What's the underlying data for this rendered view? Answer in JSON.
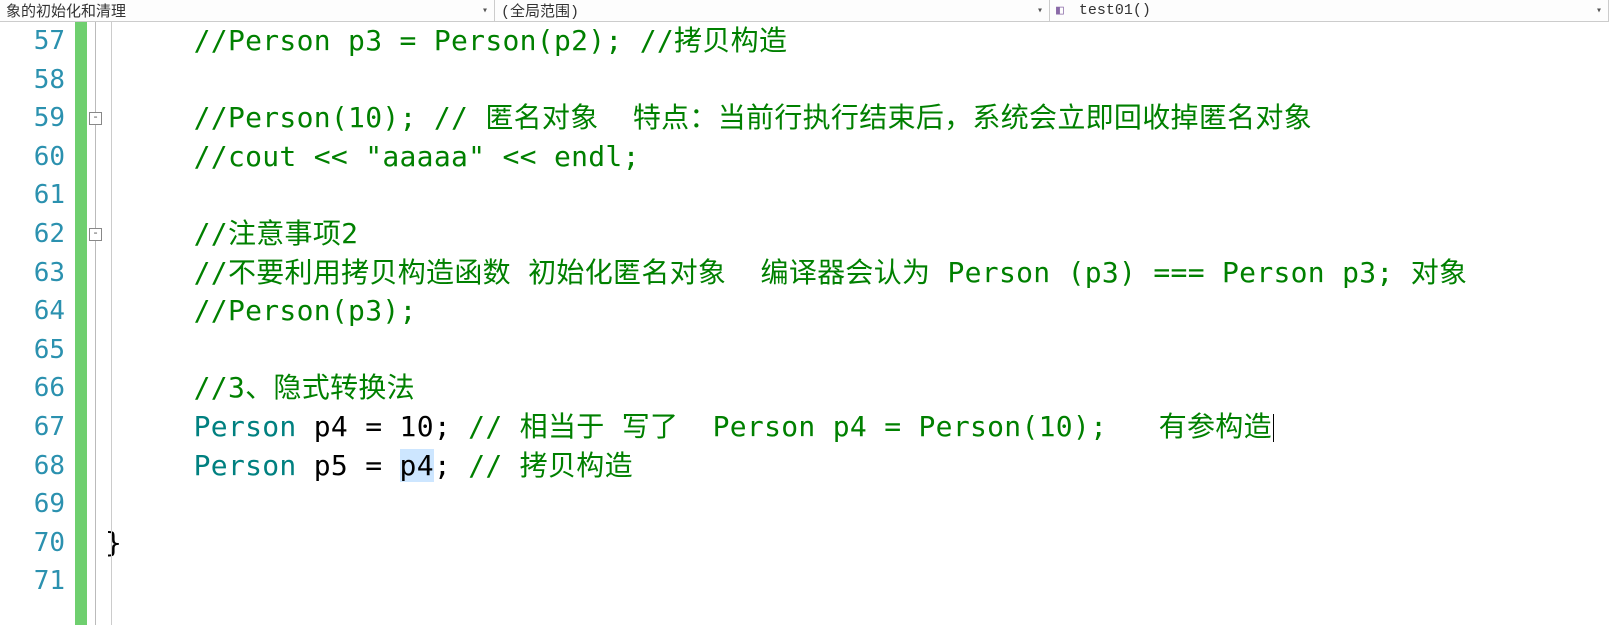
{
  "dropdowns": {
    "left": "象的初始化和清理",
    "middle": "(全局范围)",
    "right": "test01()"
  },
  "lines": {
    "start": 57,
    "end": 71
  },
  "fold": {
    "row59": "-",
    "row62": "-"
  },
  "code": {
    "l57": "//Person p3 = Person(p2); //拷贝构造",
    "l58": "",
    "l59": "//Person(10); // 匿名对象  特点：当前行执行结束后，系统会立即回收掉匿名对象",
    "l60": "//cout << \"aaaaa\" << endl;",
    "l61": "",
    "l62": "//注意事项2",
    "l63": "//不要利用拷贝构造函数 初始化匿名对象  编译器会认为 Person (p3) === Person p3; 对象",
    "l64": "//Person(p3);",
    "l65": "",
    "l66": "//3、隐式转换法",
    "l67_type": "Person",
    "l67_decl": " p4 = 10; ",
    "l67_c": "// 相当于 写了  Person p4 = Person(10);   有参构造",
    "l68_type": "Person",
    "l68_a": " p5 = ",
    "l68_hl": "p4",
    "l68_b": "; ",
    "l68_c": "// 拷贝构造",
    "l69": "",
    "l70": "}",
    "l71": ""
  }
}
